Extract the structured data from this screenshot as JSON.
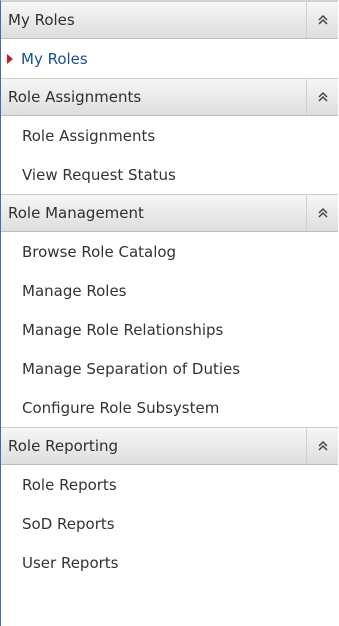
{
  "sections": [
    {
      "title": "My Roles",
      "items": [
        {
          "label": "My Roles",
          "active": true
        }
      ]
    },
    {
      "title": "Role Assignments",
      "items": [
        {
          "label": "Role Assignments"
        },
        {
          "label": "View Request Status"
        }
      ]
    },
    {
      "title": "Role Management",
      "items": [
        {
          "label": "Browse Role Catalog"
        },
        {
          "label": "Manage Roles"
        },
        {
          "label": "Manage Role Relationships"
        },
        {
          "label": "Manage Separation of Duties"
        },
        {
          "label": "Configure Role Subsystem"
        }
      ]
    },
    {
      "title": "Role Reporting",
      "items": [
        {
          "label": "Role Reports"
        },
        {
          "label": "SoD Reports"
        },
        {
          "label": "User Reports"
        }
      ]
    }
  ],
  "colors": {
    "active_marker": "#cc1b1b",
    "left_border": "#3a6fb4"
  },
  "icons": {
    "collapse": "double-chevron-up-icon",
    "active": "triangle-right-icon"
  }
}
